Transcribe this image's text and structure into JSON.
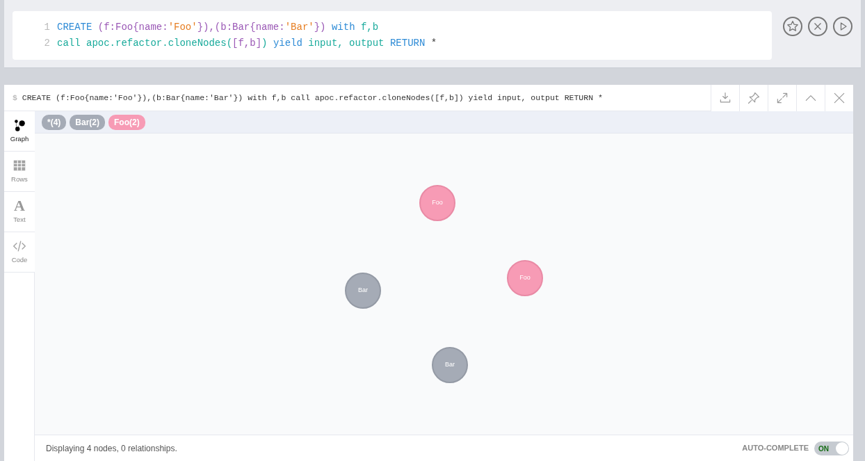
{
  "editor": {
    "lines": [
      {
        "number": "1",
        "tokens": [
          {
            "kind": "keyword",
            "text": "CREATE "
          },
          {
            "kind": "pattern",
            "text": "(f:Foo{name:"
          },
          {
            "kind": "string",
            "text": "'Foo'"
          },
          {
            "kind": "pattern",
            "text": "}),(b:Bar{name:"
          },
          {
            "kind": "string",
            "text": "'Bar'"
          },
          {
            "kind": "pattern",
            "text": "}) "
          },
          {
            "kind": "keyword",
            "text": "with "
          },
          {
            "kind": "variable",
            "text": "f,b"
          }
        ]
      },
      {
        "number": "2",
        "tokens": [
          {
            "kind": "variable",
            "text": "call apoc.refactor.cloneNodes("
          },
          {
            "kind": "pattern",
            "text": "[f,b]"
          },
          {
            "kind": "variable",
            "text": ") "
          },
          {
            "kind": "keyword",
            "text": "yield "
          },
          {
            "kind": "variable",
            "text": "input, output "
          },
          {
            "kind": "keyword",
            "text": "RETURN "
          },
          {
            "kind": "plain",
            "text": "*"
          }
        ]
      }
    ]
  },
  "editor_actions": [
    {
      "kind": "star"
    },
    {
      "kind": "clear"
    },
    {
      "kind": "run"
    }
  ],
  "result": {
    "prompt": "$",
    "query": "CREATE (f:Foo{name:'Foo'}),(b:Bar{name:'Bar'}) with f,b call apoc.refactor.cloneNodes([f,b]) yield input, output RETURN *",
    "actions": [
      {
        "kind": "download"
      },
      {
        "kind": "pin"
      },
      {
        "kind": "expand"
      },
      {
        "kind": "collapse"
      },
      {
        "kind": "close"
      }
    ],
    "views": [
      {
        "kind": "graph",
        "label": "Graph",
        "selected": true
      },
      {
        "kind": "rows",
        "label": "Rows",
        "selected": false
      },
      {
        "kind": "text",
        "glyph": "A",
        "label": "Text",
        "selected": false
      },
      {
        "kind": "code",
        "label": "Code",
        "selected": false
      }
    ],
    "labels": [
      {
        "text": "*(4)",
        "color": "#a5abb6"
      },
      {
        "text": "Bar(2)",
        "color": "#a5abb6"
      },
      {
        "text": "Foo(2)",
        "color": "#f79bb5"
      }
    ],
    "nodes": [
      {
        "label": "Foo",
        "color": "#f79bb5"
      },
      {
        "label": "Foo",
        "color": "#f79bb5"
      },
      {
        "label": "Bar",
        "color": "#a5abb6"
      },
      {
        "label": "Bar",
        "color": "#a5abb6"
      }
    ],
    "status": "Displaying 4 nodes, 0 relationships.",
    "autocomplete": {
      "label": "AUTO-COMPLETE",
      "on": true,
      "state_text": "ON"
    }
  }
}
